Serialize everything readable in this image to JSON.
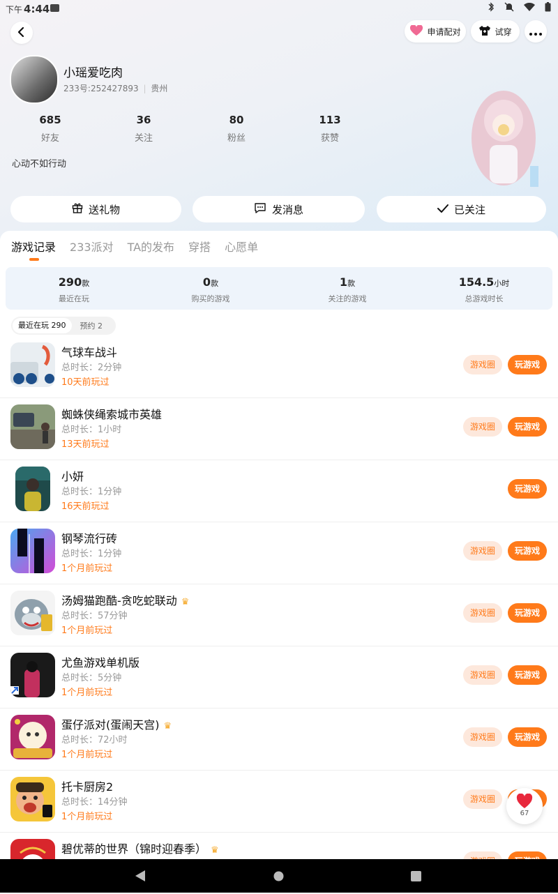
{
  "status_bar": {
    "ampm": "下午",
    "time": "4:44"
  },
  "header": {
    "apply_pair_label": "申请配对",
    "try_on_label": "试穿"
  },
  "profile": {
    "username": "小瑶爱吃肉",
    "user_id": "233号:252427893",
    "location": "贵州",
    "bio": "心动不如行动",
    "stats": [
      {
        "value": "685",
        "label": "好友"
      },
      {
        "value": "36",
        "label": "关注"
      },
      {
        "value": "80",
        "label": "粉丝"
      },
      {
        "value": "113",
        "label": "获赞"
      }
    ]
  },
  "actions": {
    "gift_label": "送礼物",
    "message_label": "发消息",
    "following_label": "已关注"
  },
  "tabs": [
    "游戏记录",
    "233派对",
    "TA的发布",
    "穿搭",
    "心愿单"
  ],
  "summary": [
    {
      "value": "290",
      "unit": "款",
      "label": "最近在玩"
    },
    {
      "value": "0",
      "unit": "款",
      "label": "购买的游戏"
    },
    {
      "value": "1",
      "unit": "款",
      "label": "关注的游戏"
    },
    {
      "value": "154.5",
      "unit": "小时",
      "label": "总游戏时长"
    }
  ],
  "segment": {
    "recent": "最近在玩 290",
    "reserve": "预约 2"
  },
  "game_buttons": {
    "circle": "游戏圈",
    "play": "玩游戏"
  },
  "games": [
    {
      "title": "气球车战斗",
      "duration": "总时长：2分钟",
      "last_played": "10天前玩过",
      "has_circle": true,
      "crown": false
    },
    {
      "title": "蜘蛛侠绳索城市英雄",
      "duration": "总时长：1小时",
      "last_played": "13天前玩过",
      "has_circle": true,
      "crown": false
    },
    {
      "title": "小妍",
      "duration": "总时长：1分钟",
      "last_played": "16天前玩过",
      "has_circle": false,
      "crown": false
    },
    {
      "title": "钢琴流行砖",
      "duration": "总时长：1分钟",
      "last_played": "1个月前玩过",
      "has_circle": true,
      "crown": false
    },
    {
      "title": "汤姆猫跑酷-贪吃蛇联动",
      "duration": "总时长：57分钟",
      "last_played": "1个月前玩过",
      "has_circle": true,
      "crown": true
    },
    {
      "title": "尤鱼游戏单机版",
      "duration": "总时长：5分钟",
      "last_played": "1个月前玩过",
      "has_circle": true,
      "crown": false
    },
    {
      "title": "蛋仔派对(蛋闹天宫)",
      "duration": "总时长：72小时",
      "last_played": "1个月前玩过",
      "has_circle": true,
      "crown": true
    },
    {
      "title": "托卡厨房2",
      "duration": "总时长：14分钟",
      "last_played": "1个月前玩过",
      "has_circle": true,
      "crown": false
    },
    {
      "title": "碧优蒂的世界（锦时迎春季）",
      "duration": "",
      "last_played": "",
      "has_circle": true,
      "crown": true
    }
  ],
  "fab": {
    "count": "67"
  },
  "colors": {
    "accent": "#ff7a1a",
    "accent_light": "#fde8dc",
    "summary_bg": "#eef4fb"
  }
}
